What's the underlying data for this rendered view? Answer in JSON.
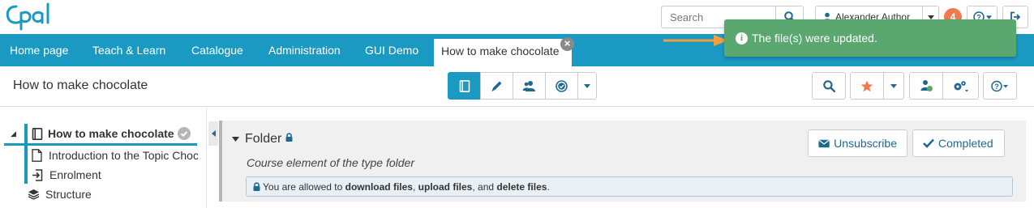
{
  "app": {
    "logo_text": "Opal"
  },
  "header": {
    "search_placeholder": "Search",
    "user_name": "Alexander Author",
    "notification_count": "4"
  },
  "nav": {
    "items": [
      {
        "label": "Home page"
      },
      {
        "label": "Teach & Learn"
      },
      {
        "label": "Catalogue"
      },
      {
        "label": "Administration"
      },
      {
        "label": "GUI Demo"
      }
    ],
    "active_tab": "How to make chocolate"
  },
  "toast": {
    "message": "The file(s) were updated."
  },
  "title_bar": {
    "course_title": "How to make chocolate"
  },
  "sidebar": {
    "tree": [
      {
        "label": "How to make chocolate",
        "icon": "book-icon"
      },
      {
        "label": "Introduction to the Topic Chocolate",
        "icon": "document-icon"
      },
      {
        "label": "Enrolment",
        "icon": "enrolment-icon"
      },
      {
        "label": "Structure",
        "icon": "layers-icon"
      }
    ]
  },
  "content": {
    "folder_title": "Folder",
    "description": "Course element of the type folder",
    "info": {
      "prefix": "You are allowed to",
      "download": "download files",
      "sep1": ",",
      "upload": "upload files",
      "sep2": ", and",
      "delete": "delete files",
      "suffix": "."
    },
    "unsubscribe_label": "Unsubscribe",
    "completed_label": "Completed"
  },
  "colors": {
    "brand": "#1a9ac3",
    "toast": "#5aa870",
    "badge": "#f0794f",
    "arrow": "#f0a040",
    "star": "#f0794f"
  }
}
